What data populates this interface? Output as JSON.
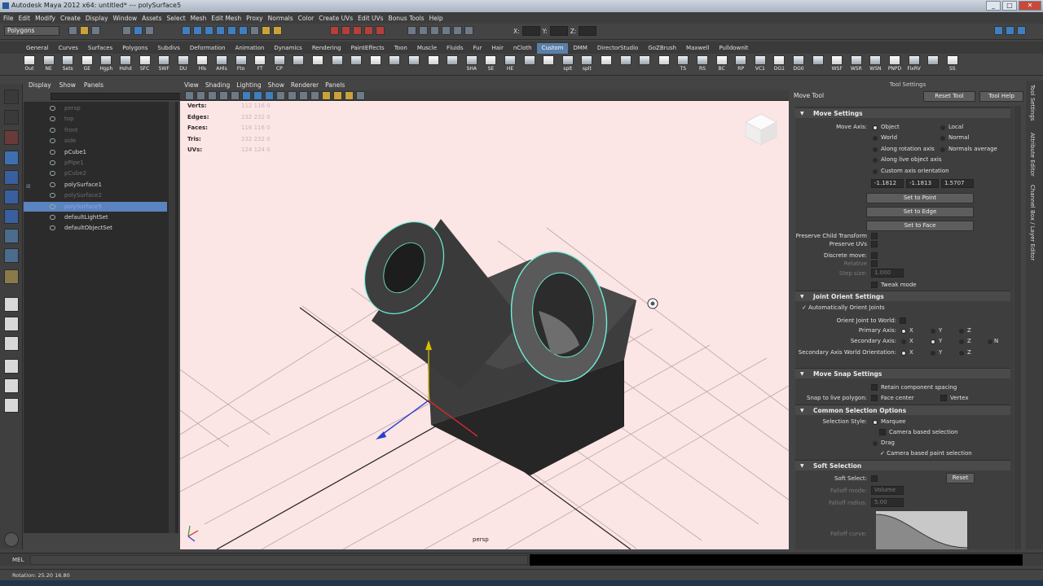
{
  "window": {
    "title": "Autodesk Maya 2012 x64: untitled*   ---   polySurface5",
    "controls": [
      "_",
      "□",
      "✕"
    ]
  },
  "menu": [
    "File",
    "Edit",
    "Modify",
    "Create",
    "Display",
    "Window",
    "Assets",
    "Select",
    "Mesh",
    "Edit Mesh",
    "Proxy",
    "Normals",
    "Color",
    "Create UVs",
    "Edit UVs",
    "Bonus Tools",
    "Help"
  ],
  "status": {
    "mode": "Polygons",
    "x_label": "X:",
    "y_label": "Y:",
    "z_label": "Z:"
  },
  "shelf_tabs": [
    "General",
    "Curves",
    "Surfaces",
    "Polygons",
    "Subdivs",
    "Deformation",
    "Animation",
    "Dynamics",
    "Rendering",
    "PaintEffects",
    "Toon",
    "Muscle",
    "Fluids",
    "Fur",
    "Hair",
    "nCloth",
    "Custom",
    "DMM",
    "DirectorStudio",
    "GoZBrush",
    "Maxwell",
    "Pulldownlt"
  ],
  "shelf_active": "Custom",
  "shelf_buttons": [
    "Out",
    "NE",
    "Sets",
    "GE",
    "Hgph",
    "Hshd",
    "SFC",
    "SWF",
    "DU",
    "Hls",
    "AHls",
    "Fto",
    "FT",
    "CP",
    "",
    "",
    "",
    "",
    "",
    "",
    "",
    "",
    "",
    "SHA",
    "SE",
    "HE",
    "",
    "",
    "splt",
    "splt",
    "",
    "",
    "",
    "",
    "TS",
    "RS",
    "BC",
    "RP",
    "VC1",
    "DG1",
    "DG0",
    "",
    "WSF",
    "WSR",
    "WSN",
    "PNPD",
    "FixRV",
    "",
    "SS"
  ],
  "outliner": {
    "menu": [
      "Display",
      "Show",
      "Panels"
    ],
    "items": [
      {
        "label": "persp",
        "dim": true
      },
      {
        "label": "top",
        "dim": true
      },
      {
        "label": "front",
        "dim": true
      },
      {
        "label": "side",
        "dim": true
      },
      {
        "label": "pCube1",
        "dim": false
      },
      {
        "label": "pPipe1",
        "dim": true
      },
      {
        "label": "pCube2",
        "dim": true
      },
      {
        "label": "polySurface1",
        "dim": false
      },
      {
        "label": "polySurface2",
        "dim": true
      },
      {
        "label": "polySurface5",
        "dim": false,
        "selected": true
      },
      {
        "label": "defaultLightSet",
        "dim": false
      },
      {
        "label": "defaultObjectSet",
        "dim": false
      }
    ]
  },
  "viewport": {
    "menu": [
      "View",
      "Shading",
      "Lighting",
      "Show",
      "Renderer",
      "Panels"
    ],
    "hud_labels": [
      "Verts:",
      "Edges:",
      "Faces:",
      "Tris:",
      "UVs:"
    ],
    "hud_values": [
      "   112      116      0",
      "   232      232      0",
      "   116      116      0",
      "   232      232      0",
      "   124      124      0"
    ],
    "camera": "persp"
  },
  "tool_settings": {
    "title": "Tool Settings",
    "tool_name": "Move Tool",
    "reset_tool": "Reset Tool",
    "tool_help": "Tool Help",
    "move_settings": {
      "header": "Move Settings",
      "move_axis_label": "Move Axis:",
      "options": [
        "Object",
        "Local",
        "World",
        "Normal",
        "Along rotation axis",
        "Normals average",
        "Along live object axis",
        "Custom axis orientation"
      ],
      "values": [
        "-1.1812",
        "-1.1813",
        "1.5707"
      ],
      "set_to_point": "Set to Point",
      "set_to_edge": "Set to Edge",
      "set_to_face": "Set to Face",
      "preserve_child": "Preserve Child Transform",
      "preserve_uvs": "Preserve UVs",
      "discrete_move": "Discrete move:",
      "relative": "Relative",
      "step_size": "Step size:",
      "step_value": "1.000",
      "tweak_mode": "Tweak mode"
    },
    "joint_orient": {
      "header": "Joint Orient Settings",
      "auto": "Automatically Orient Joints",
      "orient_world": "Orient Joint to World:",
      "primary": "Primary Axis:",
      "secondary": "Secondary Axis:",
      "secondary_world": "Secondary Axis World Orientation:",
      "axes": [
        "X",
        "Y",
        "Z"
      ],
      "none": "N"
    },
    "move_snap": {
      "header": "Move Snap Settings",
      "retain": "Retain component spacing",
      "snap_live": "Snap to live polygon:",
      "face_center": "Face center",
      "vertex": "Vertex"
    },
    "common_selection": {
      "header": "Common Selection Options",
      "style_label": "Selection Style:",
      "marquee": "Marquee",
      "camera_based": "Camera based selection",
      "drag": "Drag",
      "camera_paint": "Camera based paint selection"
    },
    "soft_selection": {
      "header": "Soft Selection",
      "soft_select": "Soft Select:",
      "reset": "Reset",
      "falloff_mode": "Falloff mode:",
      "falloff_value": "Volume",
      "falloff_radius": "Falloff radius:",
      "radius_value": "5.00",
      "falloff_curve": "Falloff curve:"
    }
  },
  "side_tabs": [
    "Tool Settings",
    "Attribute Editor",
    "Channel Box / Layer Editor"
  ],
  "command_line": {
    "label": "MEL"
  },
  "help_line": {
    "text": "Rotation:  25.20    16.80"
  }
}
